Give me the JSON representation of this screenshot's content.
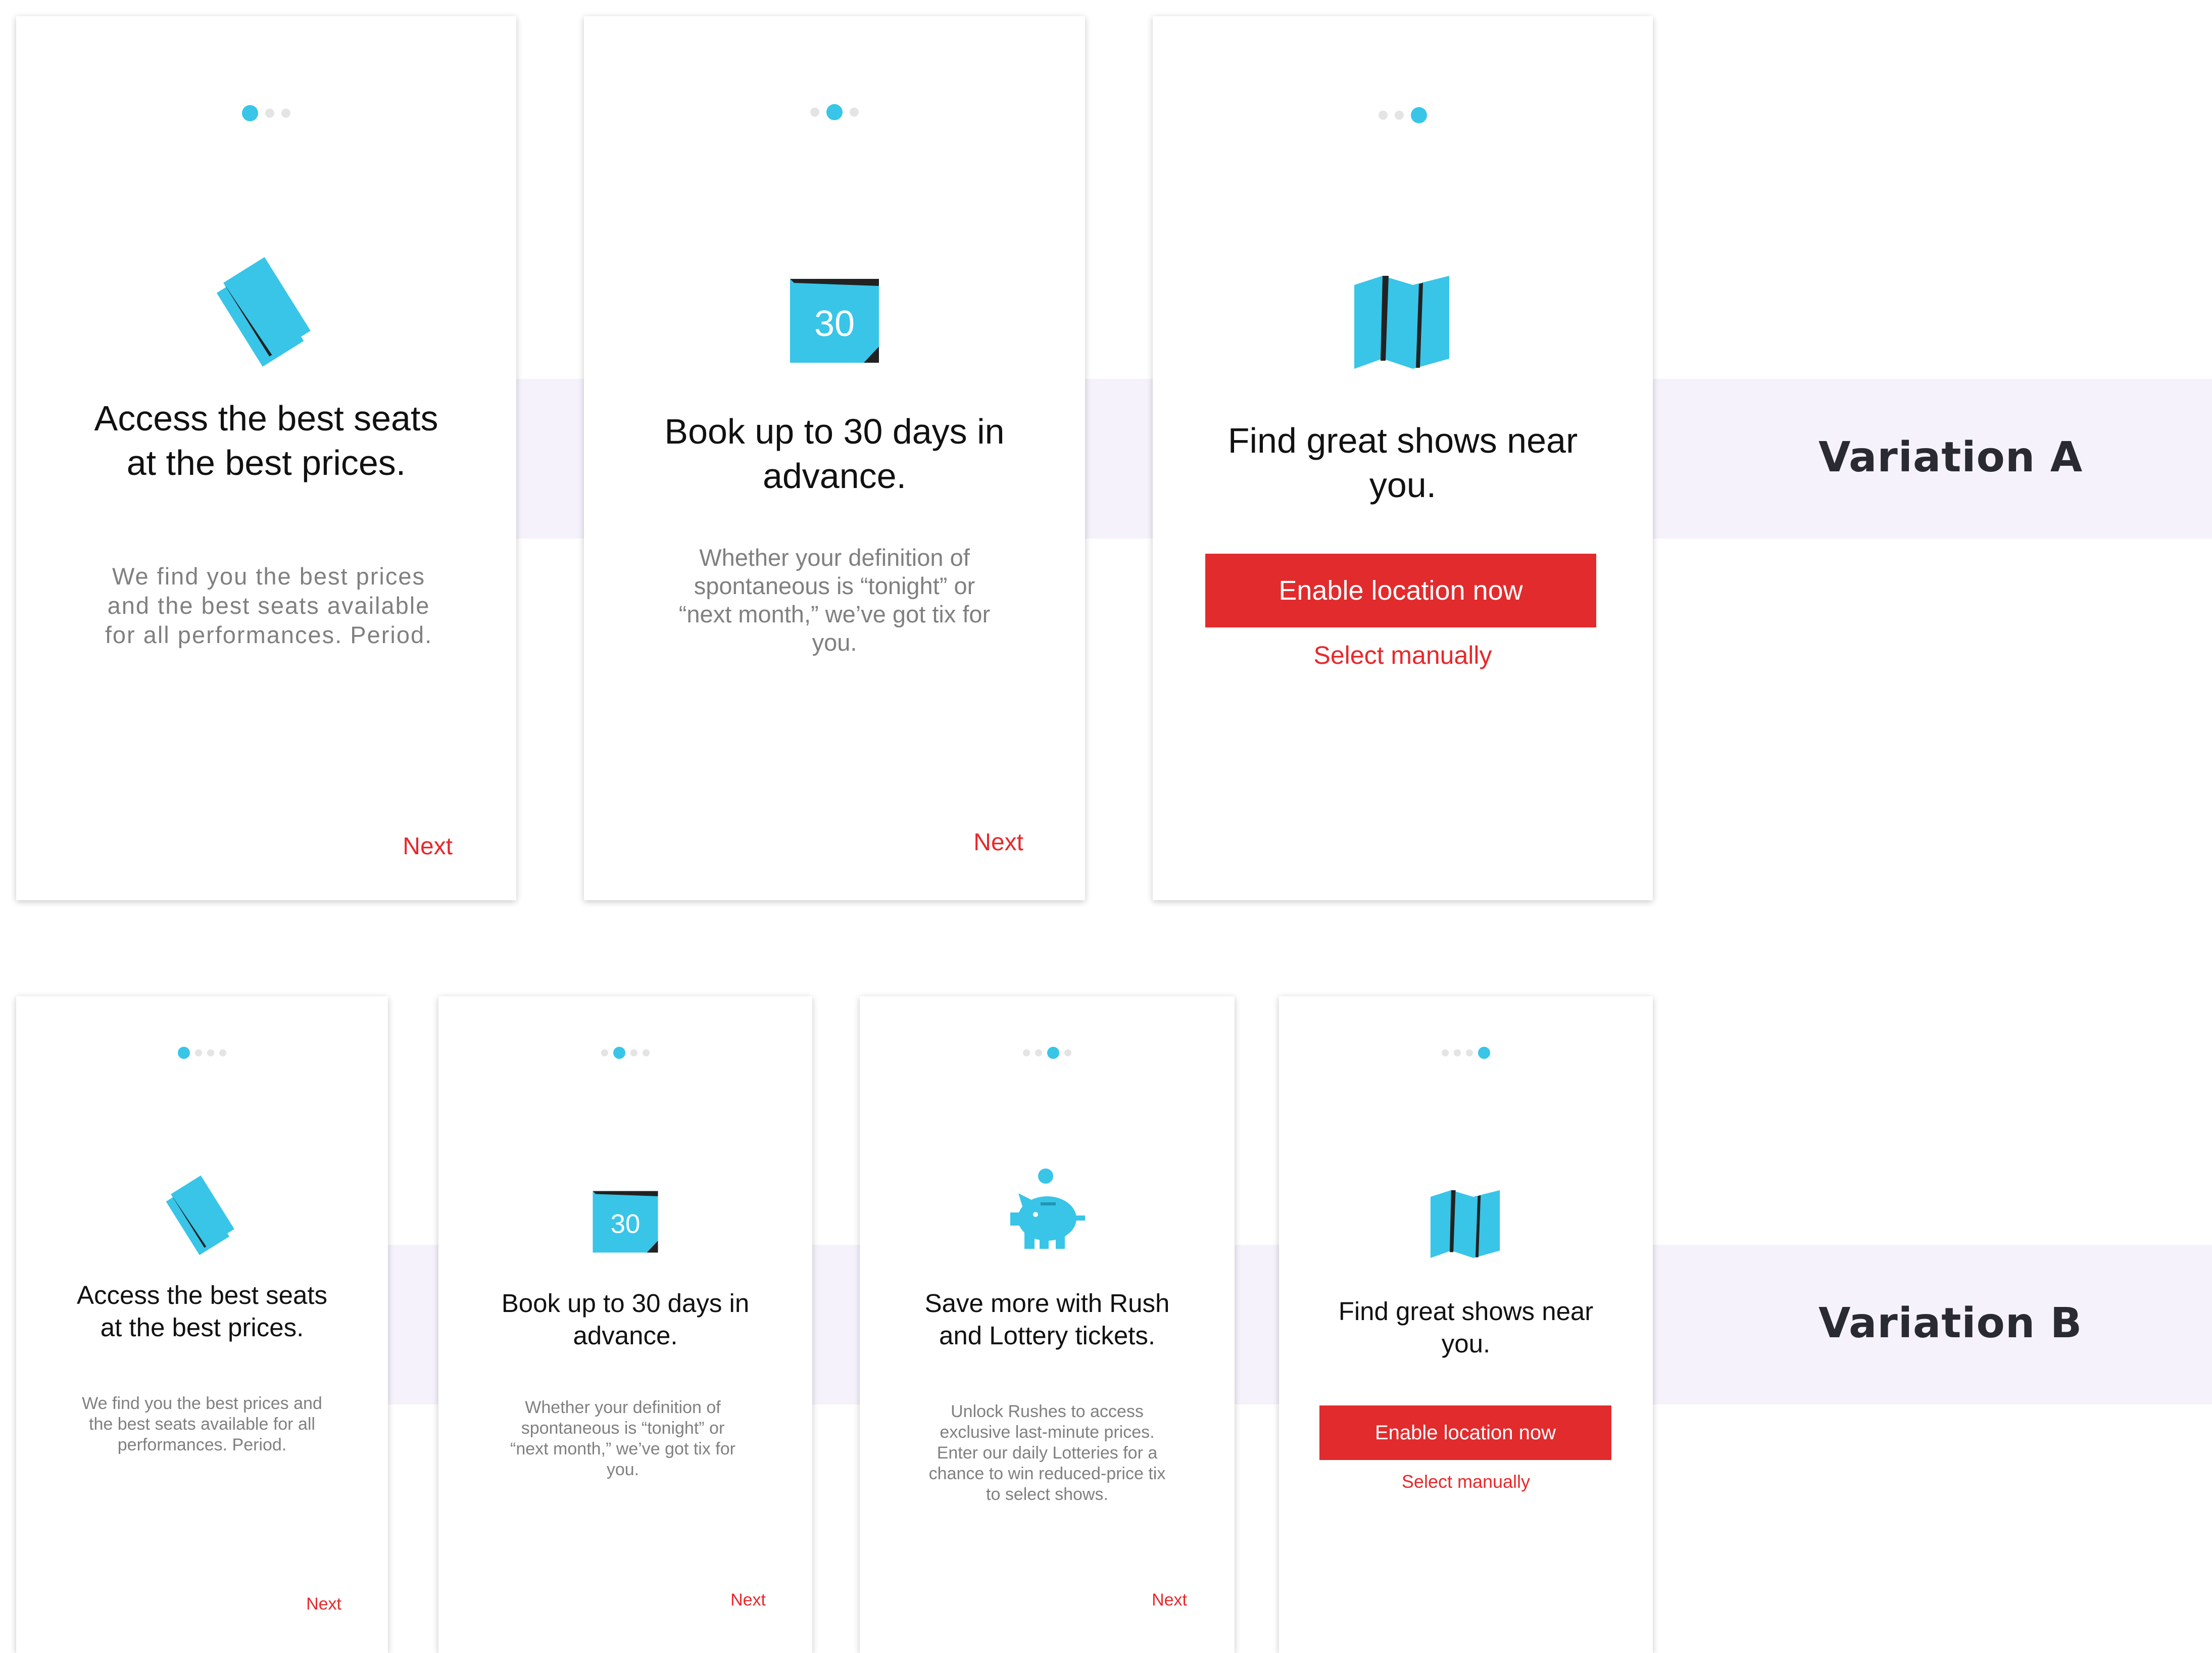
{
  "variation_a": {
    "label": "Variation A",
    "screens": [
      {
        "title": "Access the best seats at the best prices.",
        "body": "We find you the best prices and the best seats available for all performances. Period.",
        "next": "Next",
        "icon": "tickets-icon"
      },
      {
        "title": "Book up to 30 days in advance.",
        "body": "Whether your definition of spontaneous is “tonight” or “next month,” we’ve got tix for you.",
        "next": "Next",
        "icon": "calendar-icon",
        "calendar_number": "30"
      },
      {
        "title": "Find great shows near you.",
        "button": "Enable location now",
        "link": "Select manually",
        "icon": "map-icon"
      }
    ]
  },
  "variation_b": {
    "label": "Variation B",
    "screens": [
      {
        "title": "Access the best seats at the best prices.",
        "body": "We find you the best prices and the best seats available for all performances. Period.",
        "next": "Next",
        "icon": "tickets-icon"
      },
      {
        "title": "Book up to 30 days in advance.",
        "body": "Whether your definition of spontaneous is “tonight” or “next month,” we’ve got tix for you.",
        "next": "Next",
        "icon": "calendar-icon",
        "calendar_number": "30"
      },
      {
        "title": "Save more with Rush and Lottery tickets.",
        "body": "Unlock Rushes to access exclusive last-minute prices. Enter our daily Lotteries for a chance to win reduced-price tix to select shows.",
        "next": "Next",
        "icon": "piggy-bank-icon"
      },
      {
        "title": "Find great shows near you.",
        "button": "Enable location now",
        "link": "Select manually",
        "icon": "map-icon"
      }
    ]
  },
  "colors": {
    "accent": "#38c5e8",
    "brand_red": "#e22b2d",
    "band": "#f5f2fc",
    "dot_inactive": "#e4e4e4"
  }
}
